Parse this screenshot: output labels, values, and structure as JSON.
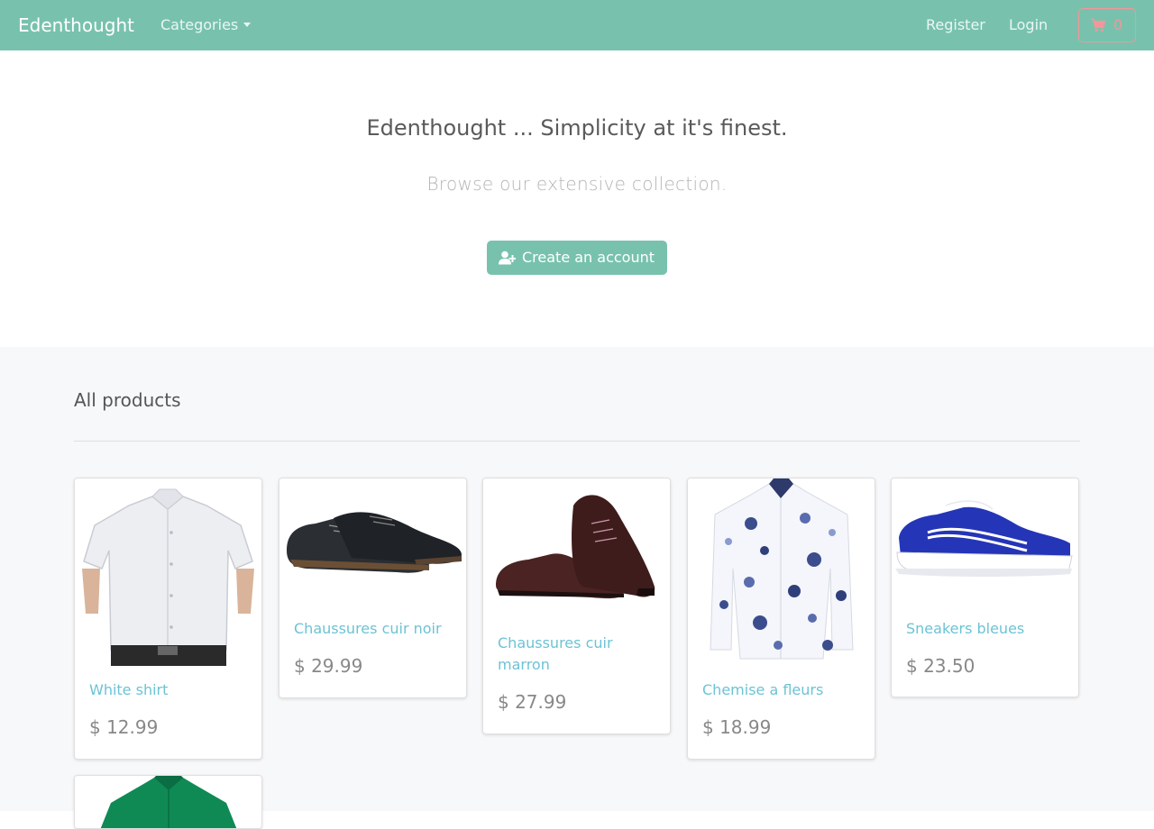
{
  "navbar": {
    "brand": "Edenthought",
    "categories_label": "Categories",
    "register_label": "Register",
    "login_label": "Login",
    "cart_count": "0"
  },
  "hero": {
    "title": "Edenthought ... Simplicity at it's finest.",
    "subtitle": "Browse our extensive collection.",
    "cta_label": "Create an account"
  },
  "products": {
    "section_title": "All products",
    "items": [
      {
        "name": "White shirt",
        "price": "$ 12.99"
      },
      {
        "name": "Chaussures cuir noir",
        "price": "$ 29.99"
      },
      {
        "name": "Chaussures cuir marron",
        "price": "$ 27.99"
      },
      {
        "name": "Chemise a fleurs",
        "price": "$ 18.99"
      },
      {
        "name": "Sneakers bleues",
        "price": "$ 23.50"
      }
    ]
  },
  "colors": {
    "primary": "#78c2ad",
    "secondary": "#f3969a",
    "link": "#6cc3d5",
    "section_bg": "#f7f8fa"
  }
}
